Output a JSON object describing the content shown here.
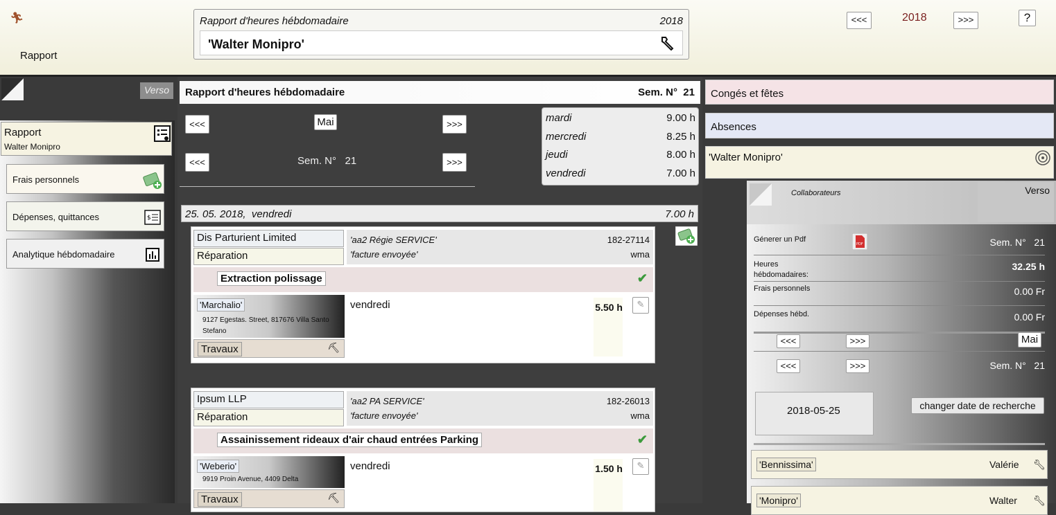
{
  "header": {
    "rapport_label": "Rapport",
    "title_box": {
      "title": "Rapport d'heures hébdomadaire",
      "year": "2018",
      "name": "'Walter Monipro'"
    },
    "year_nav": {
      "prev": "<<<",
      "year": "2018",
      "next": ">>>"
    },
    "help": "?"
  },
  "left": {
    "verso": "Verso",
    "rapport": {
      "title": "Rapport",
      "subtitle": "Walter Monipro"
    },
    "items": [
      {
        "label": "Frais personnels"
      },
      {
        "label": "Dépenses, quittances"
      },
      {
        "label": "Analytique hébdomadaire"
      }
    ]
  },
  "center": {
    "title": "Rapport d'heures hébdomadaire",
    "week_label": "Sem. N°  21",
    "month_nav": {
      "prev": "<<<",
      "month": "Mai",
      "next": ">>>"
    },
    "week_nav": {
      "prev": "<<<",
      "week": "Sem. N°   21",
      "next": ">>>"
    },
    "days": [
      {
        "day": "mardi",
        "hours": "9.00 h"
      },
      {
        "day": "mercredi",
        "hours": "8.25 h"
      },
      {
        "day": "jeudi",
        "hours": "8.00 h"
      },
      {
        "day": "vendredi",
        "hours": "7.00 h"
      }
    ],
    "date_bar": {
      "date": "25. 05. 2018,  vendredi",
      "total": "7.00 h"
    },
    "entries": [
      {
        "client": "Dis Parturient Limited",
        "type": "Réparation",
        "service": "'aa2 Régie SERVICE'",
        "number": "182-27114",
        "status": "'facture envoyée'",
        "user": "wma",
        "job": "Extraction polissage",
        "site": "'Marchalio'",
        "address": "9127 Egestas. Street, 817676 Villa Santo Stefano",
        "work": "Travaux",
        "day": "vendredi",
        "hours": "5.50 h"
      },
      {
        "client": "Ipsum LLP",
        "type": "Réparation",
        "service": "'aa2 PA SERVICE'",
        "number": "182-26013",
        "status": "'facture envoyée'",
        "user": "wma",
        "job": "Assainissement rideaux d'air chaud entrées Parking",
        "site": "'Weberio'",
        "address": "9919 Proin Avenue, 4409 Delta",
        "work": "Travaux",
        "day": "vendredi",
        "hours": "1.50 h"
      }
    ]
  },
  "right": {
    "conges": "Congés et fêtes",
    "absences": "Absences",
    "person": "'Walter Monipro'",
    "panel": {
      "collab": "Collaborateurs",
      "verso": "Verso",
      "pdf_label": "Génerer un Pdf",
      "week_label": "Sem. N°   21",
      "heures_label": "Heures hébdomadaires:",
      "heures_value": "32.25 h",
      "frais_label": "Frais personnels",
      "frais_value": "0.00 Fr",
      "depenses_label": "Dépenses hébd.",
      "depenses_value": "0.00 Fr",
      "nav_prev": "<<<",
      "nav_next": ">>>",
      "month": "Mai",
      "week2": "Sem. N°   21",
      "date": "2018-05-25",
      "change_btn": "changer date de recherche"
    },
    "collaborators": [
      {
        "tag": "'Bennissima'",
        "name": "Valérie"
      },
      {
        "tag": "'Monipro'",
        "name": "Walter"
      }
    ]
  },
  "colors": {
    "header_bg": "#f1efdb",
    "accent": "#7a1f1f",
    "check": "#3c9a3c",
    "conges_bg": "#f5e3e6",
    "absences_bg": "#e4e8f5"
  }
}
